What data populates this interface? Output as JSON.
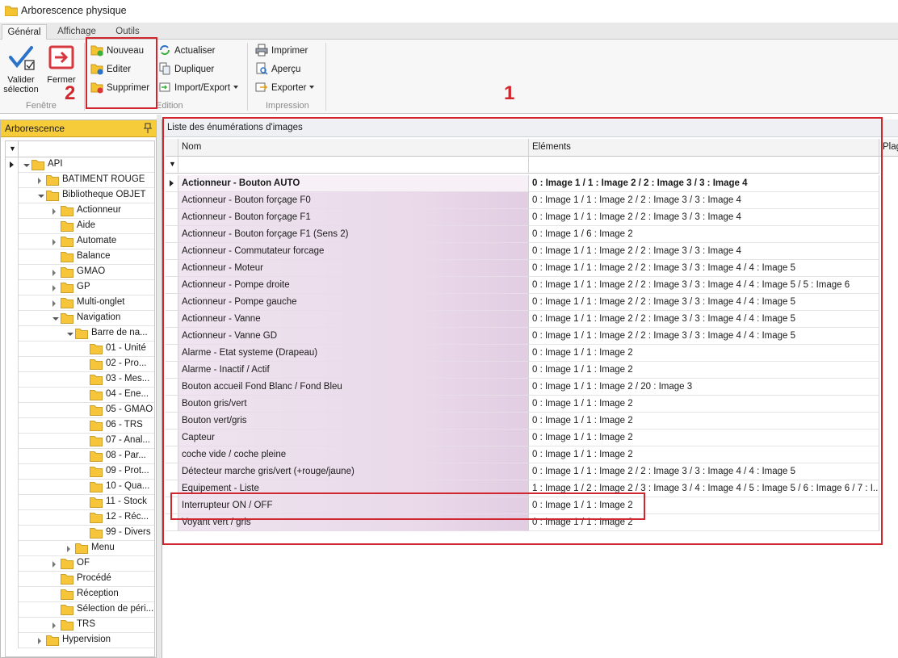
{
  "window": {
    "title": "Arborescence physique"
  },
  "tabs": [
    "Général",
    "Affichage",
    "Outils"
  ],
  "ribbon": {
    "valider": "Valider\nsélection",
    "fermer": "Fermer",
    "fenetre_group": "Fenêtre",
    "nouveau": "Nouveau",
    "editer": "Editer",
    "supprimer": "Supprimer",
    "actualiser": "Actualiser",
    "dupliquer": "Dupliquer",
    "import_export": "Import/Export",
    "edition_group": "Edition",
    "imprimer": "Imprimer",
    "apercu": "Aperçu",
    "exporter": "Exporter",
    "impression_group": "Impression"
  },
  "tree": {
    "header": "Arborescence",
    "nodes": [
      {
        "label": "API",
        "depth": 0,
        "expanded": true,
        "selected": true
      },
      {
        "label": "BATIMENT ROUGE",
        "depth": 1,
        "expander": "closed"
      },
      {
        "label": "Bibliotheque OBJET",
        "depth": 1,
        "expanded": true
      },
      {
        "label": "Actionneur",
        "depth": 2,
        "expander": "closed"
      },
      {
        "label": "Aide",
        "depth": 2
      },
      {
        "label": "Automate",
        "depth": 2,
        "expander": "closed"
      },
      {
        "label": "Balance",
        "depth": 2
      },
      {
        "label": "GMAO",
        "depth": 2,
        "expander": "closed"
      },
      {
        "label": "GP",
        "depth": 2,
        "expander": "closed"
      },
      {
        "label": "Multi-onglet",
        "depth": 2,
        "expander": "closed"
      },
      {
        "label": "Navigation",
        "depth": 2,
        "expanded": true
      },
      {
        "label": "Barre de na...",
        "depth": 3,
        "expanded": true
      },
      {
        "label": "01 - Unité",
        "depth": 4
      },
      {
        "label": "02 - Pro...",
        "depth": 4
      },
      {
        "label": "03 - Mes...",
        "depth": 4
      },
      {
        "label": "04 - Ene...",
        "depth": 4
      },
      {
        "label": "05 - GMAO",
        "depth": 4
      },
      {
        "label": "06 - TRS",
        "depth": 4
      },
      {
        "label": "07 - Anal...",
        "depth": 4
      },
      {
        "label": "08 - Par...",
        "depth": 4
      },
      {
        "label": "09 - Prot...",
        "depth": 4
      },
      {
        "label": "10 - Qua...",
        "depth": 4
      },
      {
        "label": "11 - Stock",
        "depth": 4
      },
      {
        "label": "12 - Réc...",
        "depth": 4
      },
      {
        "label": "99 - Divers",
        "depth": 4
      },
      {
        "label": "Menu",
        "depth": 3,
        "expander": "closed"
      },
      {
        "label": "OF",
        "depth": 2,
        "expander": "closed"
      },
      {
        "label": "Procédé",
        "depth": 2
      },
      {
        "label": "Réception",
        "depth": 2
      },
      {
        "label": "Sélection de péri...",
        "depth": 2
      },
      {
        "label": "TRS",
        "depth": 2,
        "expander": "closed"
      },
      {
        "label": "Hypervision",
        "depth": 1,
        "expander": "closed"
      }
    ]
  },
  "grid": {
    "title": "Liste des énumérations d'images",
    "columns": [
      "Nom",
      "Eléments",
      "Plag"
    ],
    "rows": [
      {
        "name": "Actionneur - Bouton AUTO",
        "elements": "0 : Image 1 / 1 : Image 2 / 2 : Image 3 / 3 : Image 4"
      },
      {
        "name": "Actionneur - Bouton forçage F0",
        "elements": "0 : Image 1 / 1 : Image 2 / 2 : Image 3 / 3 : Image 4"
      },
      {
        "name": "Actionneur - Bouton forçage F1",
        "elements": "0 : Image 1 / 1 : Image 2 / 2 : Image 3 / 3 : Image 4"
      },
      {
        "name": "Actionneur - Bouton forçage F1 (Sens 2)",
        "elements": "0 : Image 1 / 6 : Image 2"
      },
      {
        "name": "Actionneur - Commutateur forcage",
        "elements": "0 : Image 1 / 1 : Image 2 / 2 : Image 3 / 3 : Image 4"
      },
      {
        "name": "Actionneur - Moteur",
        "elements": "0 : Image 1 / 1 : Image 2 / 2 : Image 3 / 3 : Image 4 / 4 : Image 5"
      },
      {
        "name": "Actionneur - Pompe droite",
        "elements": "0 : Image 1 / 1 : Image 2 / 2 : Image 3 / 3 : Image 4 / 4 : Image 5 / 5 : Image 6"
      },
      {
        "name": "Actionneur - Pompe gauche",
        "elements": "0 : Image 1 / 1 : Image 2 / 2 : Image 3 / 3 : Image 4 / 4 : Image 5"
      },
      {
        "name": "Actionneur - Vanne",
        "elements": "0 : Image 1 / 1 : Image 2 / 2 : Image 3 / 3 : Image 4 / 4 : Image 5"
      },
      {
        "name": "Actionneur - Vanne GD",
        "elements": "0 : Image 1 / 1 : Image 2 / 2 : Image 3 / 3 : Image 4 / 4 : Image 5"
      },
      {
        "name": "Alarme - Etat systeme (Drapeau)",
        "elements": "0 : Image 1 / 1 : Image 2"
      },
      {
        "name": "Alarme - Inactif / Actif",
        "elements": "0 : Image 1 / 1 : Image 2"
      },
      {
        "name": "Bouton accueil Fond Blanc / Fond Bleu",
        "elements": "0 : Image 1 / 1 : Image 2 / 20 : Image 3"
      },
      {
        "name": "Bouton gris/vert",
        "elements": "0 : Image 1 / 1 : Image 2"
      },
      {
        "name": "Bouton vert/gris",
        "elements": "0 : Image 1 / 1 : Image 2"
      },
      {
        "name": "Capteur",
        "elements": "0 : Image 1 / 1 : Image 2"
      },
      {
        "name": "coche vide / coche pleine",
        "elements": "0 : Image 1 / 1 : Image 2"
      },
      {
        "name": "Détecteur marche gris/vert (+rouge/jaune)",
        "elements": "0 : Image 1 / 1 : Image 2 / 2 : Image 3 / 3 : Image 4 / 4 : Image 5"
      },
      {
        "name": "Equipement - Liste",
        "elements": "1 : Image 1 / 2 : Image 2 / 3 : Image 3 / 4 : Image 4 / 5 : Image 5 / 6 : Image 6 / 7 : I..."
      },
      {
        "name": "Interrupteur ON / OFF",
        "elements": "0 : Image 1 / 1 : Image 2"
      },
      {
        "name": "Voyant vert / gris",
        "elements": "0 : Image 1 / 1 : Image 2"
      }
    ]
  },
  "annotations": [
    "1",
    "2"
  ],
  "colors": {
    "accent_red": "#d1262d",
    "panel_header": "#f7cc3a",
    "name_cell": "#e9d9e9"
  }
}
